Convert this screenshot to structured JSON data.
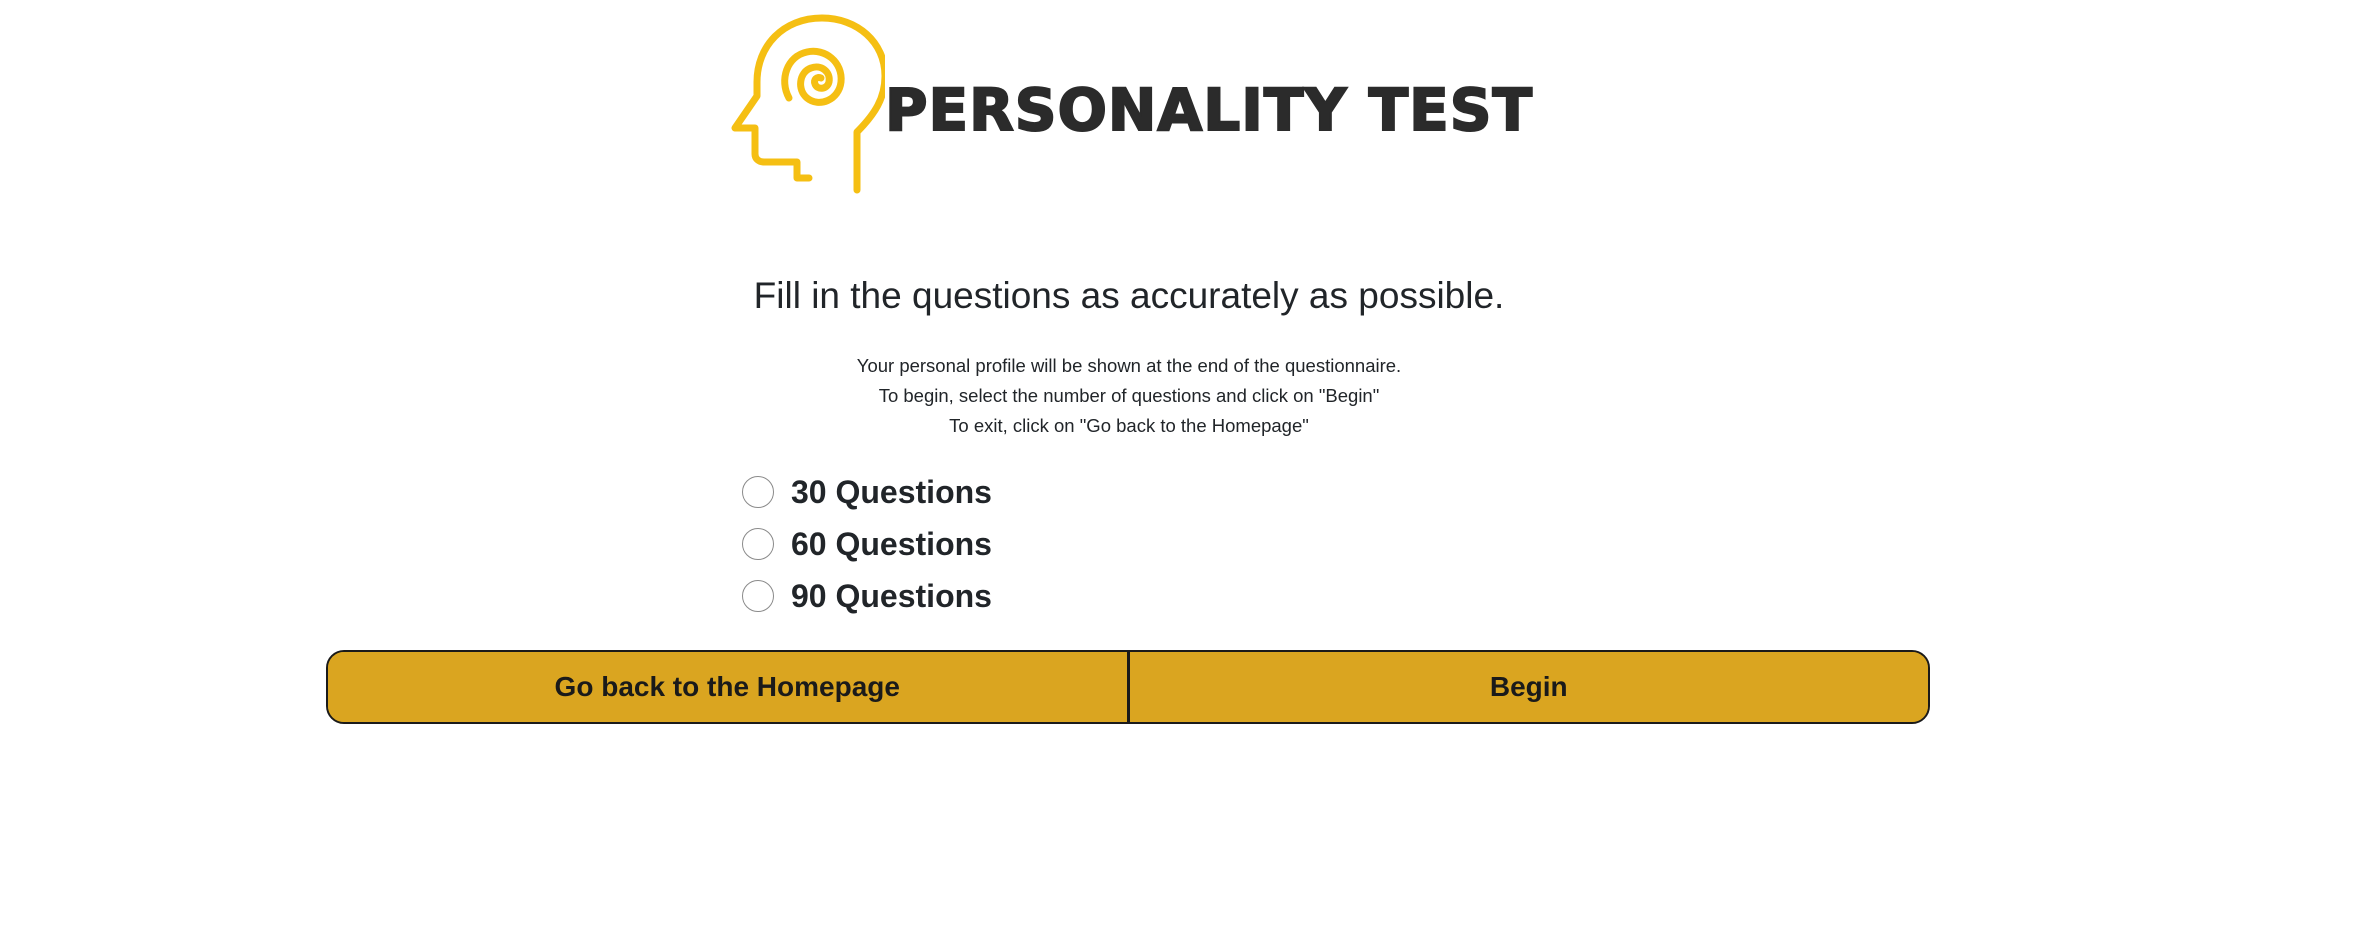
{
  "header": {
    "logo_text": "PERSONALITY TEST",
    "logo_icon": "head-spiral-icon",
    "logo_color": "#F5BF13"
  },
  "main": {
    "heading": "Fill in the questions as accurately as possible.",
    "intro_lines": [
      "Your personal profile will be shown at the end of the questionnaire.",
      "To begin, select the number of questions and click on \"Begin\"",
      "To exit, click on \"Go back to the Homepage\""
    ],
    "options": [
      {
        "label": "30 Questions",
        "selected": false
      },
      {
        "label": "60 Questions",
        "selected": false
      },
      {
        "label": "90 Questions",
        "selected": false
      }
    ]
  },
  "buttons": {
    "back_label": "Go back to the Homepage",
    "begin_label": "Begin",
    "button_color": "#DAA520"
  }
}
